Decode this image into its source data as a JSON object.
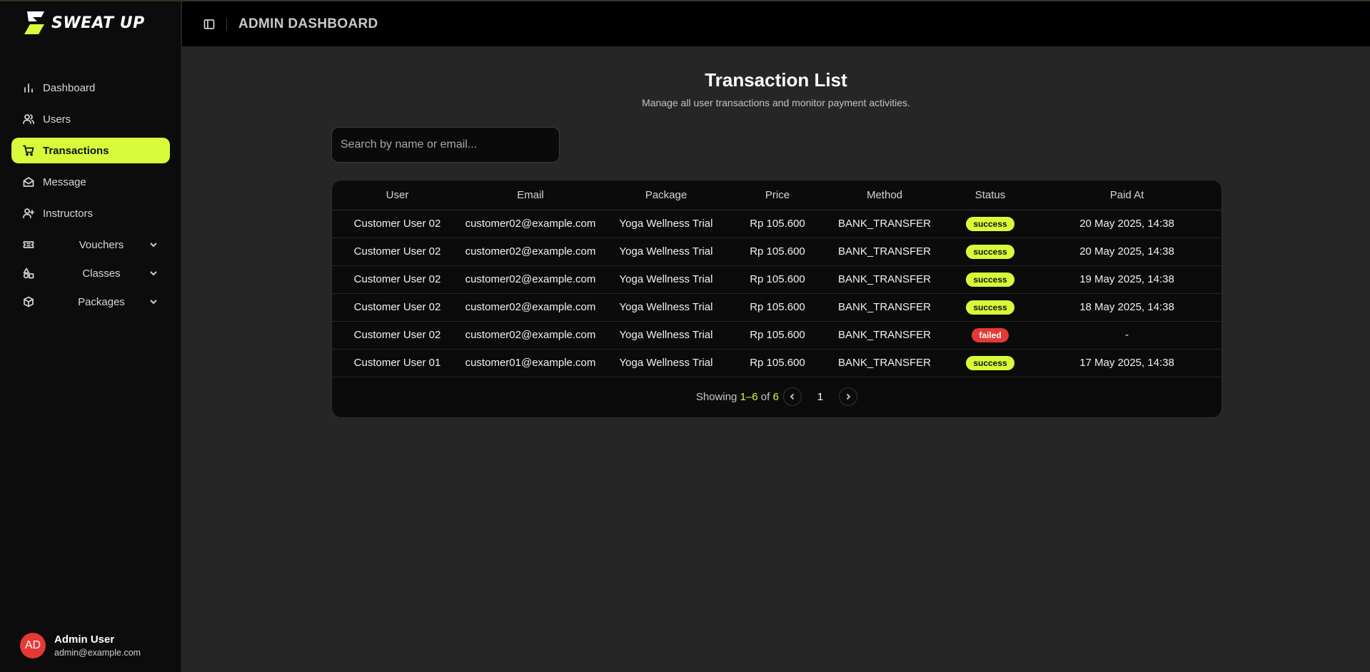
{
  "brand": {
    "name": "SWEAT UP",
    "accent": "#d7fb3a"
  },
  "header": {
    "title": "ADMIN DASHBOARD"
  },
  "sidebar": {
    "items": [
      {
        "label": "Dashboard",
        "icon": "bar-chart-icon"
      },
      {
        "label": "Users",
        "icon": "users-icon"
      },
      {
        "label": "Transactions",
        "icon": "cart-icon",
        "active": true
      },
      {
        "label": "Message",
        "icon": "mail-open-icon"
      },
      {
        "label": "Instructors",
        "icon": "user-plus-icon"
      }
    ],
    "groups": [
      {
        "label": "Vouchers",
        "icon": "ticket-icon"
      },
      {
        "label": "Classes",
        "icon": "shapes-icon"
      },
      {
        "label": "Packages",
        "icon": "package-icon"
      }
    ]
  },
  "user": {
    "initials": "AD",
    "name": "Admin User",
    "email": "admin@example.com"
  },
  "main": {
    "title": "Transaction List",
    "subtitle": "Manage all user transactions and monitor payment activities.",
    "search_placeholder": "Search by name or email..."
  },
  "table": {
    "columns": [
      "User",
      "Email",
      "Package",
      "Price",
      "Method",
      "Status",
      "Paid At"
    ],
    "rows": [
      {
        "user": "Customer User 02",
        "email": "customer02@example.com",
        "package": "Yoga Wellness Trial",
        "price": "Rp 105.600",
        "method": "BANK_TRANSFER",
        "status": "success",
        "paid_at": "20 May 2025, 14:38"
      },
      {
        "user": "Customer User 02",
        "email": "customer02@example.com",
        "package": "Yoga Wellness Trial",
        "price": "Rp 105.600",
        "method": "BANK_TRANSFER",
        "status": "success",
        "paid_at": "20 May 2025, 14:38"
      },
      {
        "user": "Customer User 02",
        "email": "customer02@example.com",
        "package": "Yoga Wellness Trial",
        "price": "Rp 105.600",
        "method": "BANK_TRANSFER",
        "status": "success",
        "paid_at": "19 May 2025, 14:38"
      },
      {
        "user": "Customer User 02",
        "email": "customer02@example.com",
        "package": "Yoga Wellness Trial",
        "price": "Rp 105.600",
        "method": "BANK_TRANSFER",
        "status": "success",
        "paid_at": "18 May 2025, 14:38"
      },
      {
        "user": "Customer User 02",
        "email": "customer02@example.com",
        "package": "Yoga Wellness Trial",
        "price": "Rp 105.600",
        "method": "BANK_TRANSFER",
        "status": "failed",
        "paid_at": "-"
      },
      {
        "user": "Customer User 01",
        "email": "customer01@example.com",
        "package": "Yoga Wellness Trial",
        "price": "Rp 105.600",
        "method": "BANK_TRANSFER",
        "status": "success",
        "paid_at": "17 May 2025, 14:38"
      }
    ]
  },
  "pagination": {
    "showing_label": "Showing",
    "range": "1–6",
    "of_label": "of",
    "total": "6",
    "current_page": "1"
  }
}
